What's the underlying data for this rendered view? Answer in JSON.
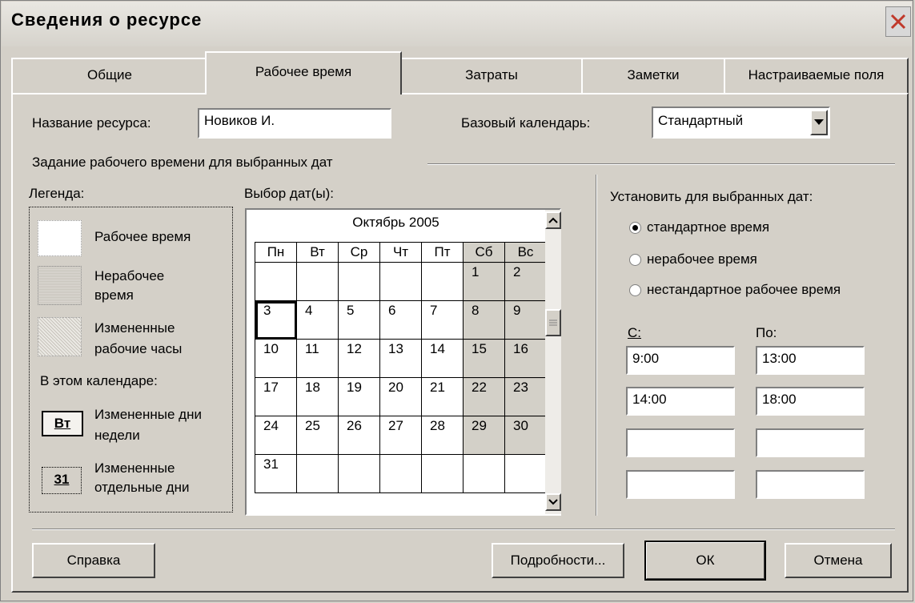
{
  "window": {
    "title": "Сведения о ресурсе"
  },
  "tabs": [
    "Общие",
    "Рабочее время",
    "Затраты",
    "Заметки",
    "Настраиваемые поля"
  ],
  "form": {
    "resource_label": "Название ресурса:",
    "resource_value": "Новиков И.",
    "base_calendar_label": "Базовый календарь:",
    "base_calendar_value": "Стандартный"
  },
  "section_title": "Задание рабочего времени для выбранных дат",
  "legend": {
    "title": "Легенда:",
    "working": "Рабочее время",
    "nonworking": "Нерабочее время",
    "modified_hours": "Измененные рабочие часы",
    "in_calendar": "В этом календаре:",
    "badge_weekday": "Вт",
    "modified_weekdays": "Измененные дни недели",
    "badge_day": "31",
    "modified_days": "Измененные отдельные дни"
  },
  "calendar": {
    "label": "Выбор дат(ы):",
    "month": "Октябрь 2005",
    "weekdays": [
      "Пн",
      "Вт",
      "Ср",
      "Чт",
      "Пт",
      "Сб",
      "Вс"
    ],
    "weeks": [
      [
        "",
        "",
        "",
        "",
        "",
        "1",
        "2"
      ],
      [
        "3",
        "4",
        "5",
        "6",
        "7",
        "8",
        "9"
      ],
      [
        "10",
        "11",
        "12",
        "13",
        "14",
        "15",
        "16"
      ],
      [
        "17",
        "18",
        "19",
        "20",
        "21",
        "22",
        "23"
      ],
      [
        "24",
        "25",
        "26",
        "27",
        "28",
        "29",
        "30"
      ],
      [
        "31",
        "",
        "",
        "",
        "",
        "",
        ""
      ]
    ],
    "selected_day": "3"
  },
  "options": {
    "title": "Установить для выбранных дат:",
    "standard": "стандартное время",
    "nonworking": "нерабочее время",
    "nonstandard": "нестандартное рабочее время",
    "selected": "standard"
  },
  "times": {
    "from_label": "С:",
    "to_label": "По:",
    "from": [
      "9:00",
      "14:00",
      "",
      ""
    ],
    "to": [
      "13:00",
      "18:00",
      "",
      ""
    ]
  },
  "buttons": {
    "help": "Справка",
    "details": "Подробности...",
    "ok": "ОК",
    "cancel": "Отмена"
  },
  "colors": {
    "dialog_bg": "#d4d0c8",
    "field_bg": "#ffffff",
    "close_x": "#c0392b"
  }
}
